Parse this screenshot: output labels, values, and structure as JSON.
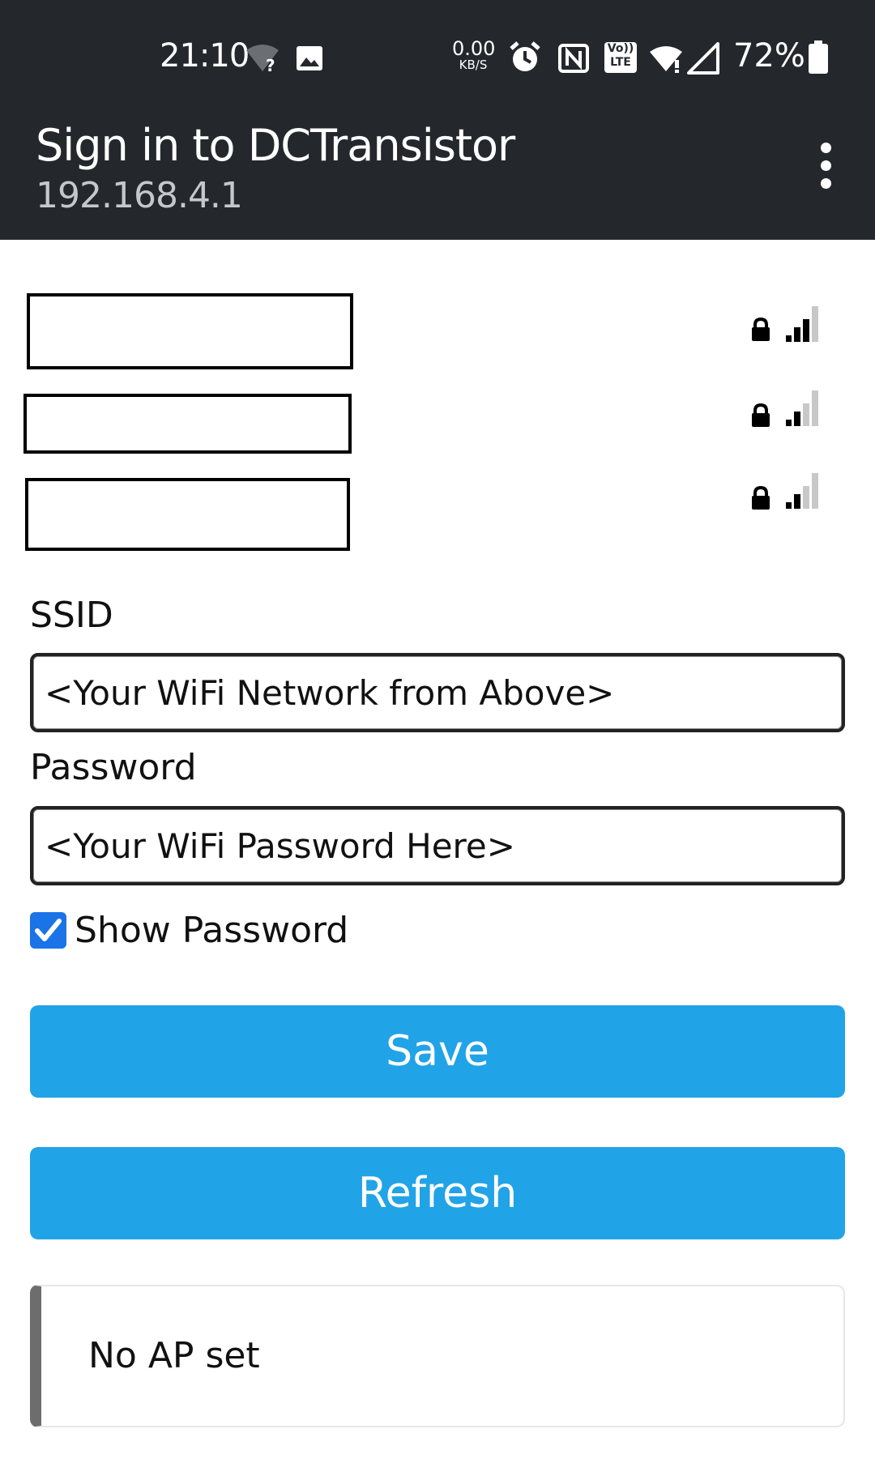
{
  "status_bar": {
    "time": "21:10",
    "data_speed_value": "0.00",
    "data_speed_unit": "KB/S",
    "volte_top": "Vo))",
    "volte_bottom": "LTE",
    "battery_percent": "72%",
    "icons": [
      "wifi-question-icon",
      "image-icon",
      "alarm-icon",
      "nfc-icon",
      "volte-icon",
      "wifi-icon",
      "cell-signal-icon",
      "battery-icon"
    ]
  },
  "app_bar": {
    "title": "Sign in to DCTransistor",
    "subtitle": "192.168.4.1",
    "menu_icon": "more-vert-icon"
  },
  "networks": [
    {
      "name": "",
      "secured": true,
      "signal_bars": 3
    },
    {
      "name": "",
      "secured": true,
      "signal_bars": 2
    },
    {
      "name": "",
      "secured": true,
      "signal_bars": 2
    }
  ],
  "form": {
    "ssid_label": "SSID",
    "ssid_placeholder": "<Your WiFi Network from Above>",
    "password_label": "Password",
    "password_placeholder": "<Your WiFi Password Here>",
    "show_password_label": "Show Password",
    "show_password_checked": true,
    "save_label": "Save",
    "refresh_label": "Refresh"
  },
  "message": {
    "text": "No AP set"
  },
  "colors": {
    "bar_background": "#24282d",
    "button_blue": "#21a3e7",
    "checkbox_blue": "#1b73e8",
    "message_accent": "#6d6d6d"
  }
}
